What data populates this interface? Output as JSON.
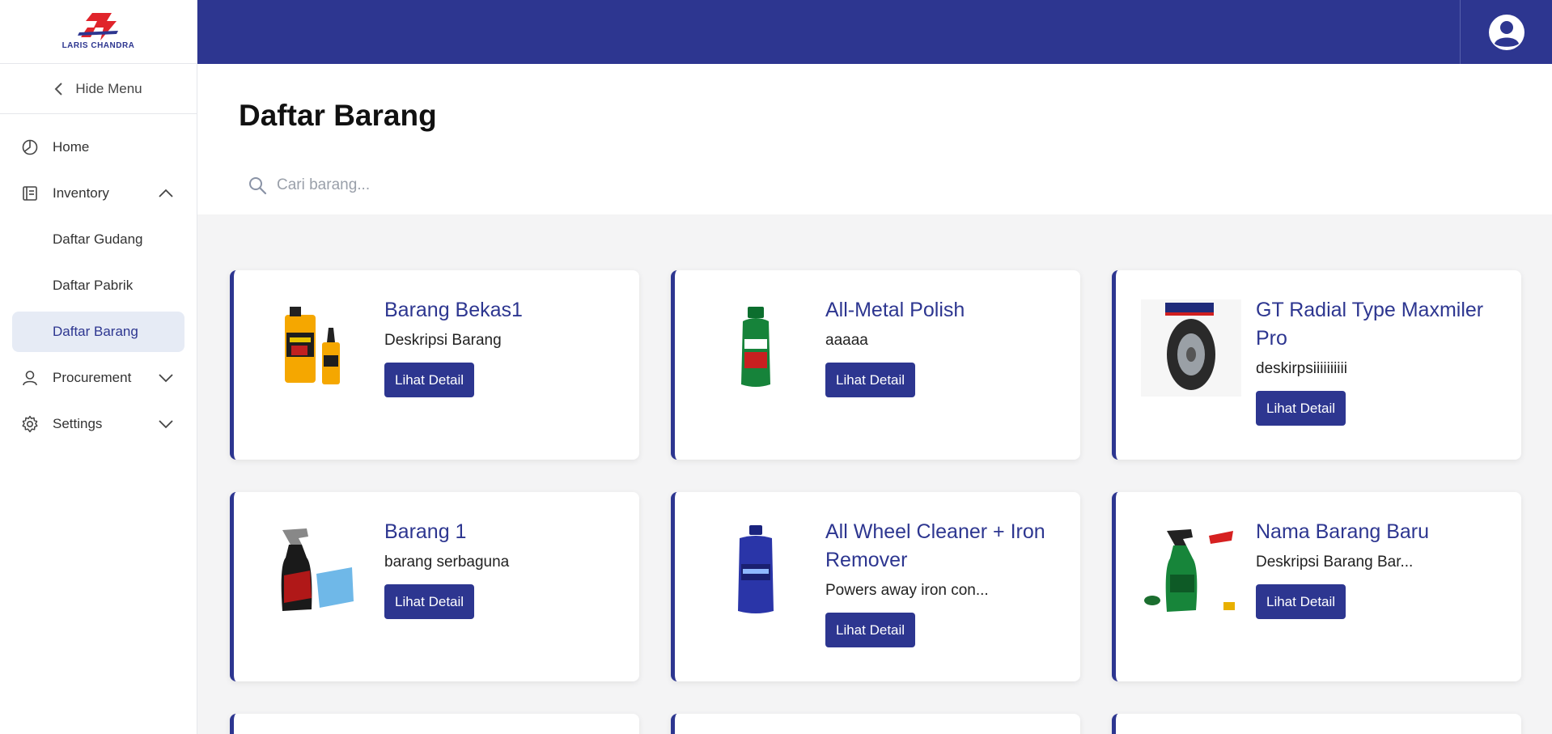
{
  "app": {
    "logo_text": "LARIS CHANDRA",
    "brand_color": "#2d3690"
  },
  "sidebar": {
    "hide_menu": "Hide Menu",
    "items": [
      {
        "label": "Home",
        "icon": "chart-pie-icon"
      },
      {
        "label": "Inventory",
        "icon": "list-document-icon",
        "expanded": true
      },
      {
        "label": "Procurement",
        "icon": "user-icon"
      },
      {
        "label": "Settings",
        "icon": "gear-icon"
      }
    ],
    "inventory_sub": [
      "Daftar Gudang",
      "Daftar Pabrik",
      "Daftar Barang"
    ],
    "active_sub": "Daftar Barang"
  },
  "header": {
    "title": "Daftar Barang",
    "search_placeholder": "Cari barang..."
  },
  "cards": [
    {
      "name": "Barang Bekas1",
      "desc": "Deskripsi Barang",
      "button": "Lihat Detail",
      "image": "oil-bottles"
    },
    {
      "name": "All-Metal Polish",
      "desc": "aaaaa",
      "button": "Lihat Detail",
      "image": "green-bottle"
    },
    {
      "name": "GT Radial Type Maxmiler Pro",
      "desc": "deskirpsiiiiiiiiii",
      "button": "Lihat Detail",
      "image": "tire"
    },
    {
      "name": "Barang 1",
      "desc": "barang serbaguna",
      "button": "Lihat Detail",
      "image": "spray-red"
    },
    {
      "name": "All Wheel Cleaner + Iron Remover",
      "desc": "Powers away iron con...",
      "button": "Lihat Detail",
      "image": "blue-bottle"
    },
    {
      "name": "Nama Barang Baru",
      "desc": "Deskripsi Barang Bar...",
      "button": "Lihat Detail",
      "image": "spray-green"
    }
  ]
}
